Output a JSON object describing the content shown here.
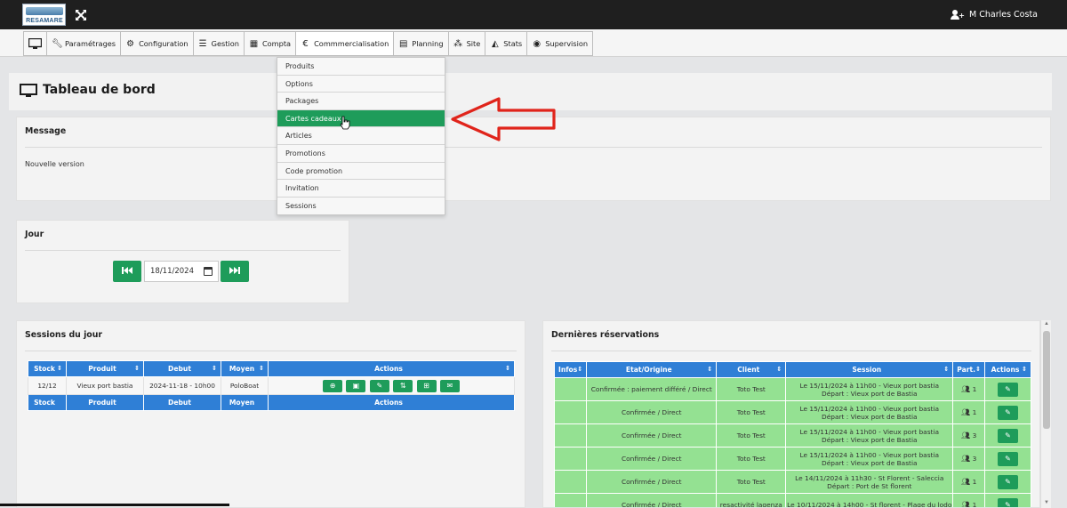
{
  "topbar": {
    "logo_text": "RESAMARE",
    "user_name": "M Charles Costa"
  },
  "nav": {
    "items": [
      {
        "label": "",
        "icon": "desktop-icon"
      },
      {
        "label": "Paramétrages",
        "icon": "wrench-icon"
      },
      {
        "label": "Configuration",
        "icon": "gears-icon"
      },
      {
        "label": "Gestion",
        "icon": "list-icon"
      },
      {
        "label": "Compta",
        "icon": "calculator-icon"
      },
      {
        "label": "Commmercialisation",
        "icon": "euro-icon"
      },
      {
        "label": "Planning",
        "icon": "calendar-icon"
      },
      {
        "label": "Site",
        "icon": "sitemap-icon"
      },
      {
        "label": "Stats",
        "icon": "area-chart-icon"
      },
      {
        "label": "Supervision",
        "icon": "eye-icon"
      }
    ]
  },
  "dropdown": {
    "items": [
      "Produits",
      "Options",
      "Packages",
      "Cartes cadeaux",
      "Articles",
      "Promotions",
      "Code promotion",
      "Invitation",
      "Sessions"
    ],
    "active_index": 3
  },
  "page": {
    "title": "Tableau de bord"
  },
  "message": {
    "title": "Message",
    "text": "Nouvelle version"
  },
  "jour": {
    "title": "Jour",
    "date_value": "18/11/2024"
  },
  "sessions": {
    "title": "Sessions du jour",
    "columns": [
      "Stock",
      "Produit",
      "Debut",
      "Moyen",
      "Actions"
    ],
    "rows": [
      {
        "stock": "12/12",
        "produit": "Vieux port bastia",
        "debut": "2024-11-18 - 10h00",
        "moyen": "PoloBoat"
      }
    ],
    "footer": [
      "Stock",
      "Produit",
      "Debut",
      "Moyen",
      "Actions"
    ]
  },
  "reservations": {
    "title": "Dernières réservations",
    "columns": [
      "Infos",
      "Etat/Origine",
      "Client",
      "Session",
      "Part.",
      "Actions"
    ],
    "rows": [
      {
        "etat": "Confirmée : paiement différé / Direct",
        "client": "Toto Test",
        "session1": "Le 15/11/2024 à 11h00 - Vieux port bastia",
        "session2": "Départ : Vieux port de Bastia",
        "part": "1"
      },
      {
        "etat": "Confirmée / Direct",
        "client": "Toto Test",
        "session1": "Le 15/11/2024 à 11h00 - Vieux port bastia",
        "session2": "Départ : Vieux port de Bastia",
        "part": "1"
      },
      {
        "etat": "Confirmée / Direct",
        "client": "Toto Test",
        "session1": "Le 15/11/2024 à 11h00 - Vieux port bastia",
        "session2": "Départ : Vieux port de Bastia",
        "part": "3"
      },
      {
        "etat": "Confirmée / Direct",
        "client": "Toto Test",
        "session1": "Le 15/11/2024 à 11h00 - Vieux port bastia",
        "session2": "Départ : Vieux port de Bastia",
        "part": "3"
      },
      {
        "etat": "Confirmée / Direct",
        "client": "Toto Test",
        "session1": "Le 14/11/2024 à 11h30 - St Florent - Saleccia",
        "session2": "Départ : Port de St florent",
        "part": "1"
      },
      {
        "etat": "Confirmée / Direct",
        "client": "resactivité lagenza",
        "session1": "Le 10/11/2024 à 14h00 - St florent - Plage du lodo",
        "session2": "",
        "part": "1"
      }
    ]
  },
  "colors": {
    "topbar": "#1f1f1f",
    "accent_green": "#1e9c5a",
    "table_header_blue": "#2f7fd6",
    "row_green": "#94e192",
    "arrow_red": "#e0241b"
  }
}
